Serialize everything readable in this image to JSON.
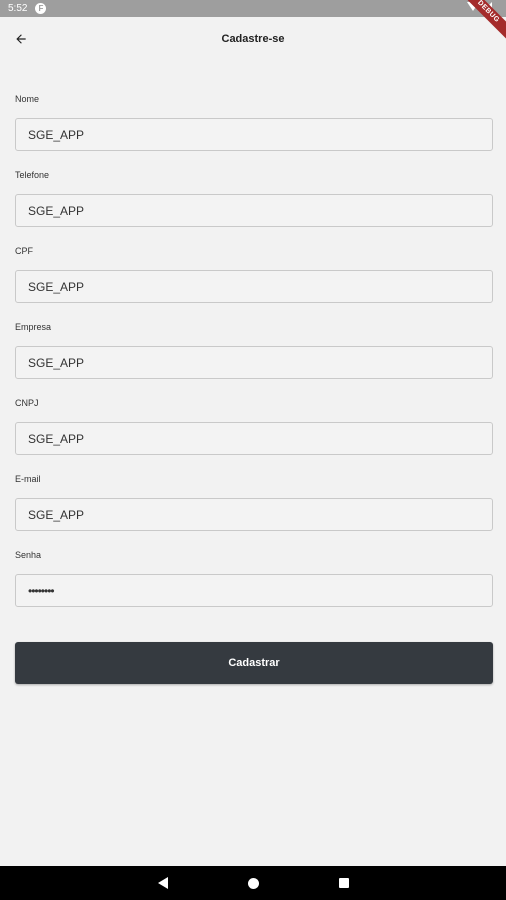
{
  "status_bar": {
    "time": "5:52",
    "badge": "F",
    "debug_label": "DEBUG"
  },
  "app_bar": {
    "title": "Cadastre-se"
  },
  "form": {
    "fields": [
      {
        "label": "Nome",
        "value": "SGE_APP"
      },
      {
        "label": "Telefone",
        "value": "SGE_APP"
      },
      {
        "label": "CPF",
        "value": "SGE_APP"
      },
      {
        "label": "Empresa",
        "value": "SGE_APP"
      },
      {
        "label": "CNPJ",
        "value": "SGE_APP"
      },
      {
        "label": "E-mail",
        "value": "SGE_APP"
      },
      {
        "label": "Senha",
        "value": "••••••••"
      }
    ],
    "submit_label": "Cadastrar"
  },
  "colors": {
    "background": "#f2f2f2",
    "button": "#353a40",
    "status_bar": "#9e9e9e"
  },
  "icons": {
    "back": "arrow-left-icon"
  }
}
